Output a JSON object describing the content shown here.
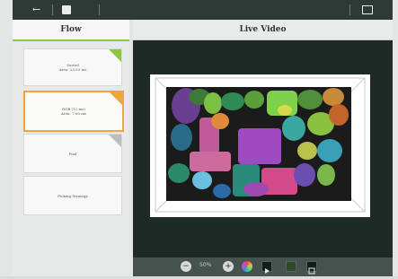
{
  "topbar": {
    "back_icon": "arrow-left-icon",
    "doc_icon": "document-icon",
    "grid_icon": "grid-icon"
  },
  "flow": {
    "title": "Flow",
    "steps": [
      {
        "name": "Sorted",
        "detail": "Area: 23.53 ms"
      },
      {
        "name": "RGB (12 ms)",
        "detail": "Area: 7.00 ms"
      },
      {
        "name": "Pool",
        "detail": ""
      },
      {
        "name": "Picking Strategy",
        "detail": ""
      }
    ]
  },
  "live_video": {
    "title": "Live Video",
    "zoom_value": "50%"
  },
  "colors": {
    "accent_green": "#8dc63f",
    "accent_orange": "#f0a43a",
    "dark_panel": "#1e2a26"
  }
}
